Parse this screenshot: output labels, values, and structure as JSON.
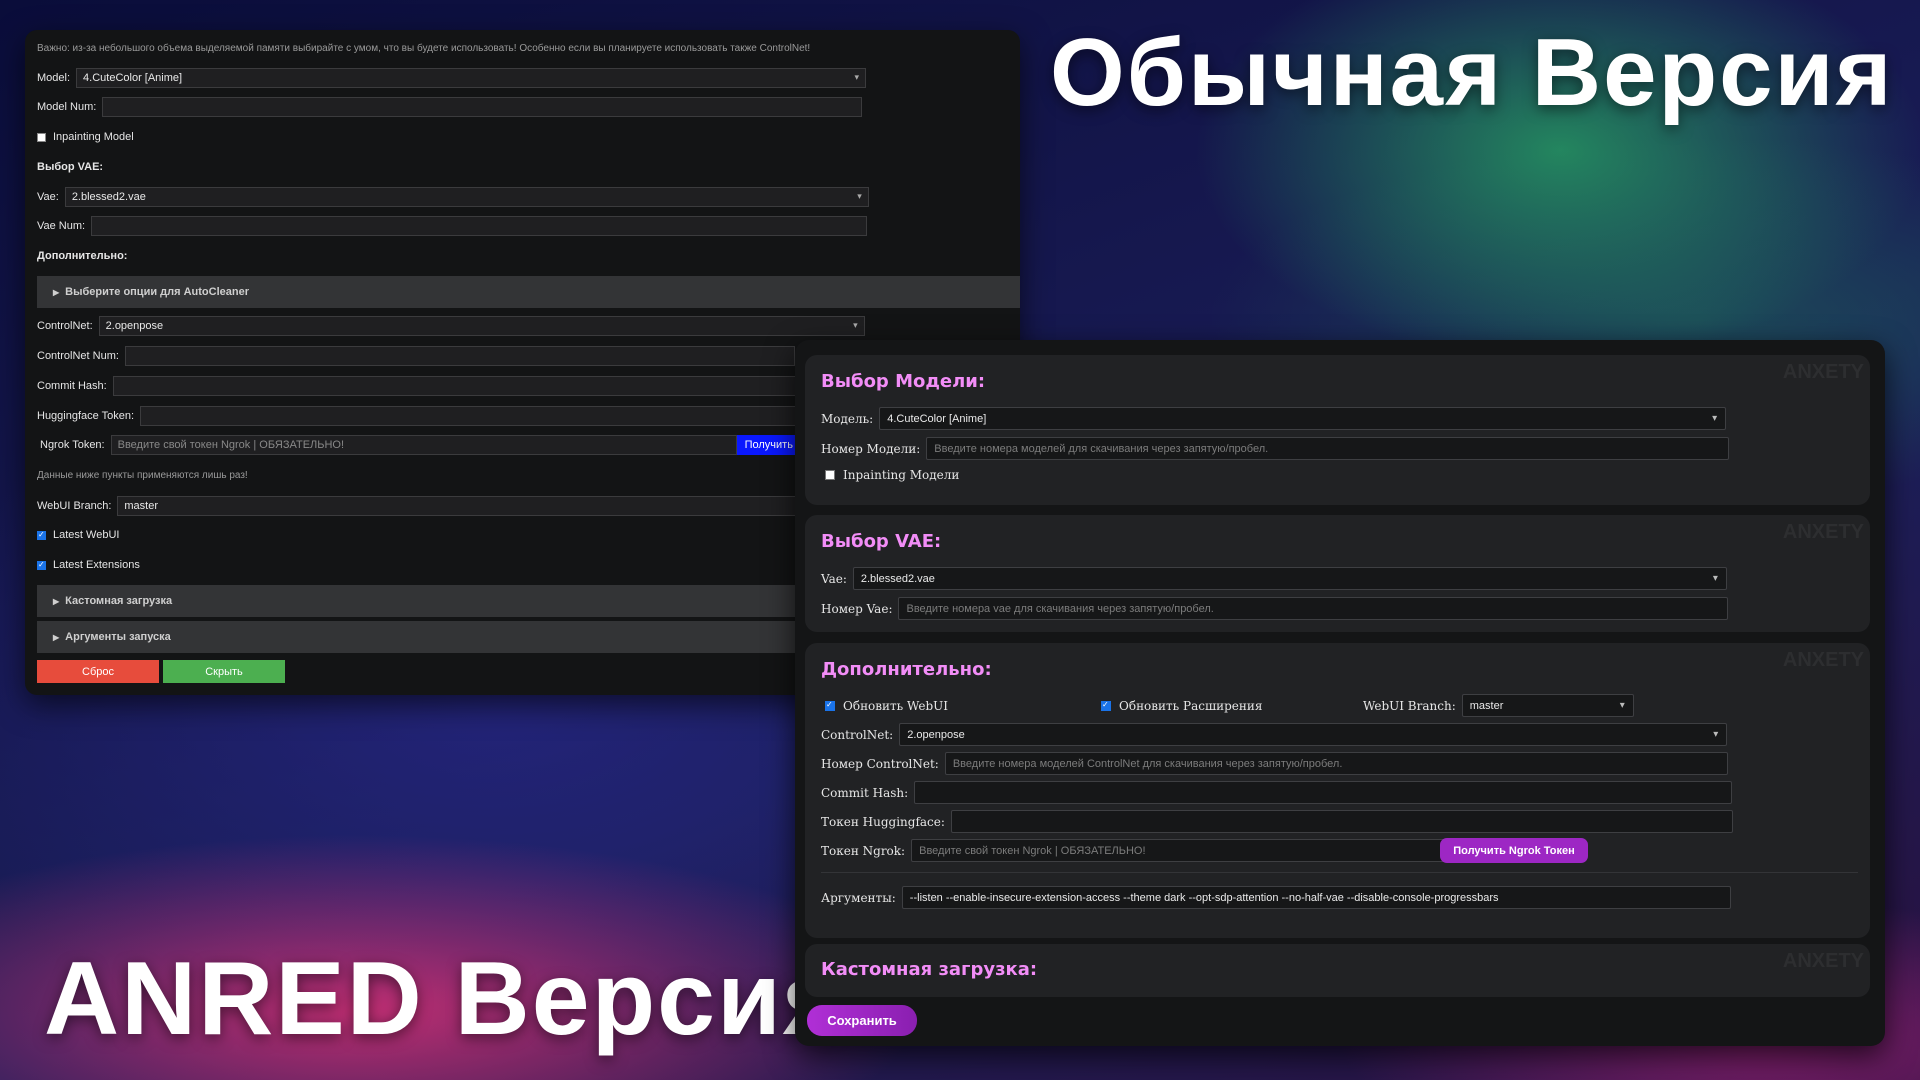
{
  "titles": {
    "top": "Обычная Версия",
    "bottom": "ANRED Версия"
  },
  "old": {
    "note": "Важно: из-за небольшого объема выделяемой памяти выбирайте с умом, что вы будете использовать! Особенно если вы планируете использовать также ControlNet!",
    "model_label": "Model:",
    "model_value": "4.CuteColor [Anime]",
    "model_num_label": "Model Num:",
    "inpainting_label": "Inpainting Model",
    "vae_heading": "Выбор VAE:",
    "vae_label": "Vae:",
    "vae_value": "2.blessed2.vae",
    "vae_num_label": "Vae Num:",
    "extra_heading": "Дополнительно:",
    "autocleaner_label": "Выберите опции для AutoCleaner",
    "controlnet_label": "ControlNet:",
    "controlnet_value": "2.openpose",
    "controlnet_num_label": "ControlNet Num:",
    "commit_label": "Commit Hash:",
    "hf_label": "Huggingface Token:",
    "ngrok_label": "Ngrok Token:",
    "ngrok_placeholder": "Введите свой токен Ngrok | ОБЯЗАТЕЛЬНО!",
    "ngrok_button": "Получить",
    "once_note": "Данные ниже пункты применяются лишь раз!",
    "branch_label": "WebUI Branch:",
    "branch_value": "master",
    "latest_webui": "Latest WebUI",
    "latest_ext": "Latest Extensions",
    "custom_download": "Кастомная загрузка",
    "launch_args": "Аргументы запуска",
    "reset_button": "Сброс",
    "hide_button": "Скрыть",
    "colors": {
      "reset": "#e74c3c",
      "hide": "#4caf50",
      "ngrok": "#0a18ff"
    }
  },
  "new": {
    "watermark": "ANXETY",
    "model_card": {
      "title": "Выбор Модели:",
      "model_label": "Модель:",
      "model_value": "4.CuteColor [Anime]",
      "num_label": "Номер Модели:",
      "num_placeholder": "Введите номера моделей для скачивания через запятую/пробел.",
      "inpainting_label": "Inpainting Модели"
    },
    "vae_card": {
      "title": "Выбор VAE:",
      "vae_label": "Vae:",
      "vae_value": "2.blessed2.vae",
      "num_label": "Номер Vae:",
      "num_placeholder": "Введите номера vae для скачивания через запятую/пробел."
    },
    "extra_card": {
      "title": "Дополнительно:",
      "update_webui": "Обновить WebUI",
      "update_ext": "Обновить Расширения",
      "branch_label": "WebUI Branch:",
      "branch_value": "master",
      "controlnet_label": "ControlNet:",
      "controlnet_value": "2.openpose",
      "controlnet_num_label": "Номер ControlNet:",
      "controlnet_num_placeholder": "Введите номера моделей ControlNet для скачивания через запятую/пробел.",
      "commit_label": "Commit Hash:",
      "hf_label": "Токен Huggingface:",
      "ngrok_label": "Токен Ngrok:",
      "ngrok_placeholder": "Введите свой токен Ngrok | ОБЯЗАТЕЛЬНО!",
      "ngrok_button": "Получить Ngrok Токен",
      "args_label": "Аргументы:",
      "args_value": "--listen --enable-insecure-extension-access --theme dark --opt-sdp-attention --no-half-vae --disable-console-progressbars"
    },
    "custom_card": {
      "title": "Кастомная загрузка:"
    },
    "save_button": "Сохранить"
  }
}
